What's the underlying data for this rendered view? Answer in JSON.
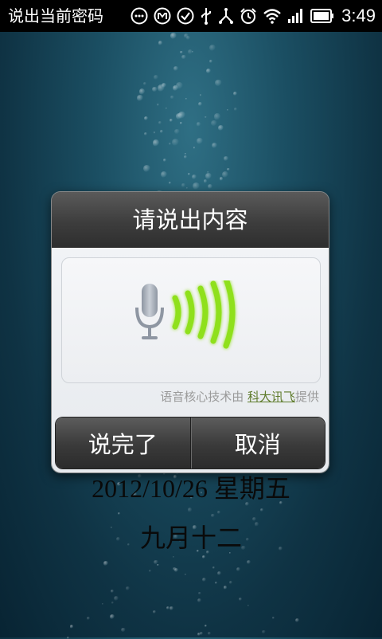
{
  "status_bar": {
    "title": "说出当前密码",
    "time": "3:49",
    "icons": [
      "ellipsis-icon",
      "m-icon",
      "check-icon",
      "usb-icon",
      "share-icon",
      "alarm-icon",
      "wifi-icon",
      "signal-icon",
      "battery-icon"
    ]
  },
  "dialog": {
    "title": "请说出内容",
    "credit_prefix": "语音核心技术由 ",
    "credit_link": "科大讯飞",
    "credit_suffix": "提供",
    "done_label": "说完了",
    "cancel_label": "取消"
  },
  "background": {
    "date": "2012/10/26   星期五",
    "lunar": "九月十二"
  },
  "colors": {
    "wave_green": "#8fe01a",
    "link": "#5d7a2a"
  }
}
